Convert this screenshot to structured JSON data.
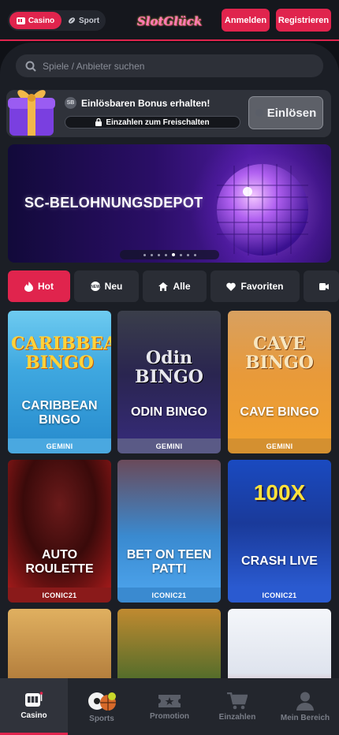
{
  "header": {
    "toggle_casino": "Casino",
    "toggle_sport": "Sport",
    "logo_text": "SlotGlück",
    "login_label": "Anmelden",
    "register_label": "Registrieren"
  },
  "search": {
    "placeholder": "Spiele / Anbieter suchen"
  },
  "bonus": {
    "coin_label": "SB",
    "title": "Einlösbaren Bonus erhalten!",
    "unlock_label": "Einzahlen zum Freischalten",
    "redeem_label": "Einlösen"
  },
  "banner": {
    "text": "SC-BELOHNUNGSDEPOT",
    "slides_total": 8,
    "active_slide": 5
  },
  "filters": [
    {
      "label": "Hot",
      "icon": "flame-icon",
      "active": true
    },
    {
      "label": "Neu",
      "icon": "new-badge-icon",
      "active": false
    },
    {
      "label": "Alle",
      "icon": "home-icon",
      "active": false
    },
    {
      "label": "Favoriten",
      "icon": "heart-icon",
      "active": false
    },
    {
      "label": "",
      "icon": "video-camera-icon",
      "active": false
    }
  ],
  "games": [
    {
      "title_art": "CARIBBEAN BINGO",
      "name": "CARIBBEAN BINGO",
      "provider": "GEMINI"
    },
    {
      "title_art": "Odin BINGO",
      "name": "ODIN BINGO",
      "provider": "GEMINI"
    },
    {
      "title_art": "CAVE BINGO",
      "name": "CAVE BINGO",
      "provider": "GEMINI"
    },
    {
      "title_art": "",
      "name": "AUTO ROULETTE",
      "provider": "ICONIC21"
    },
    {
      "title_art": "",
      "name": "BET ON TEEN PATTI",
      "provider": "ICONIC21"
    },
    {
      "title_art": "100X",
      "name": "CRASH LIVE",
      "provider": "ICONIC21"
    },
    {
      "title_art": "",
      "name": "",
      "provider": ""
    },
    {
      "title_art": "",
      "name": "",
      "provider": ""
    },
    {
      "title_art": "",
      "name": "",
      "provider": ""
    }
  ],
  "bottom_nav": [
    {
      "label": "Casino",
      "icon": "slot-machine-icon",
      "active": true
    },
    {
      "label": "Sports",
      "icon": "sports-balls-icon",
      "active": false
    },
    {
      "label": "Promotion",
      "icon": "ticket-icon",
      "active": false
    },
    {
      "label": "Einzahlen",
      "icon": "cart-icon",
      "active": false
    },
    {
      "label": "Mein Bereich",
      "icon": "user-icon",
      "active": false
    }
  ],
  "colors": {
    "accent": "#e0244d",
    "background": "#0f1116",
    "panel": "#1b1e25"
  }
}
